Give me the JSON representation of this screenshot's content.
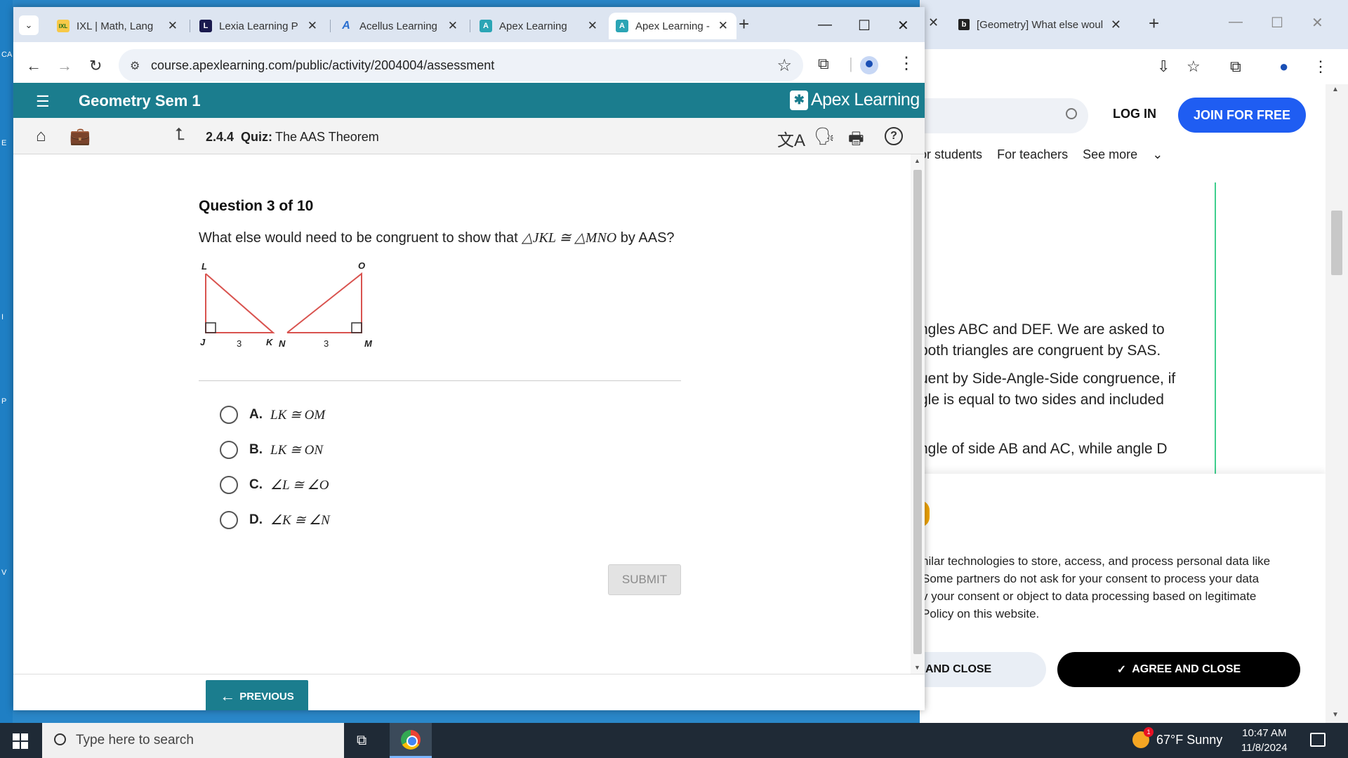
{
  "desktop_edge": [
    "CA",
    "E",
    "I",
    "P",
    "V"
  ],
  "back_window": {
    "tab_title": "[Geometry] What else woul",
    "login": "LOG IN",
    "join": "JOIN FOR FREE",
    "nav": [
      "or students",
      "For teachers",
      "See more"
    ],
    "answer_lines": [
      "ngles ABC and DEF. We are asked to",
      " both triangles are congruent by SAS.",
      "uent by Side-Angle-Side congruence, if",
      "gle is equal to two sides and included",
      "ngle of side AB and AC, while angle D"
    ],
    "consent_lines": [
      "nilar technologies to store, access, and process personal data like",
      "Some partners do not ask for your consent to process your data",
      "v your consent or object to data processing based on legitimate",
      " Policy on this website."
    ],
    "btn_close": "AND CLOSE",
    "btn_agree": "AGREE AND CLOSE"
  },
  "tabs": [
    {
      "fav": "IXL",
      "title": "IXL | Math, Lang",
      "color": "#f7c948"
    },
    {
      "fav": "L",
      "title": "Lexia Learning P",
      "color": "#1a1a4e"
    },
    {
      "fav": "A",
      "title": "Acellus Learning",
      "color": "#ffffff"
    },
    {
      "fav": "A",
      "title": "Apex Learning",
      "color": "#2ba5b5"
    },
    {
      "fav": "A",
      "title": "Apex Learning -",
      "color": "#2ba5b5"
    }
  ],
  "url": "course.apexlearning.com/public/activity/2004004/assessment",
  "course_title": "Geometry Sem 1",
  "brand": "Apex Learning",
  "activity": {
    "code": "2.4.4",
    "type": "Quiz:",
    "name": "The AAS Theorem"
  },
  "question": {
    "number": "Question 3 of 10",
    "prefix": "What else would need to be congruent to show that ",
    "statement": "△JKL ≅ △MNO",
    "suffix": " by AAS?"
  },
  "figure_labels": {
    "L": "L",
    "J": "J",
    "K": "K",
    "N": "N",
    "O": "O",
    "M": "M",
    "side1": "3",
    "side2": "3"
  },
  "options": [
    {
      "letter": "A.",
      "expr": "LK ≅ OM"
    },
    {
      "letter": "B.",
      "expr": "LK ≅ ON"
    },
    {
      "letter": "C.",
      "expr": "∠L ≅ ∠O"
    },
    {
      "letter": "D.",
      "expr": "∠K ≅ ∠N"
    }
  ],
  "submit": "SUBMIT",
  "previous": "PREVIOUS",
  "taskbar": {
    "search_placeholder": "Type here to search",
    "weather": "67°F  Sunny",
    "time": "10:47 AM",
    "date": "11/8/2024",
    "weather_badge": "1"
  }
}
